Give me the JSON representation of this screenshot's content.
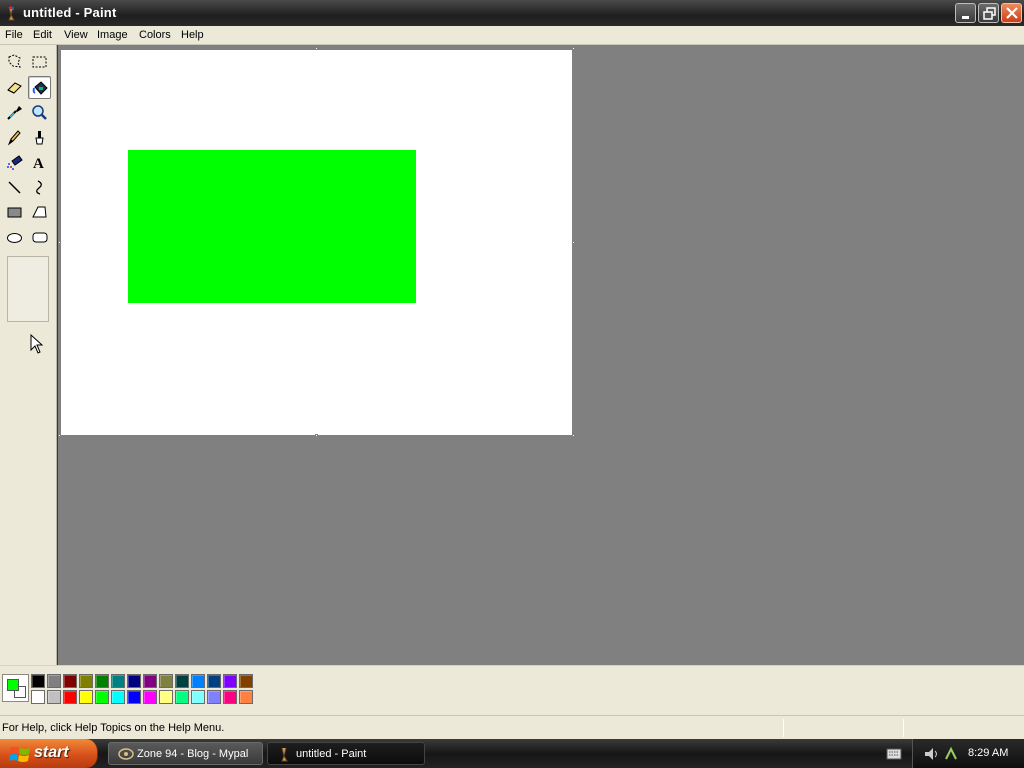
{
  "window": {
    "title": "untitled - Paint"
  },
  "menu": {
    "items": [
      "File",
      "Edit",
      "View",
      "Image",
      "Colors",
      "Help"
    ]
  },
  "toolbox": {
    "tools": [
      {
        "name": "free-form-select",
        "icon": "free-select-icon"
      },
      {
        "name": "select",
        "icon": "rect-select-icon"
      },
      {
        "name": "eraser",
        "icon": "eraser-icon"
      },
      {
        "name": "fill-with-color",
        "icon": "paint-bucket-icon",
        "active": true
      },
      {
        "name": "pick-color",
        "icon": "eyedropper-icon"
      },
      {
        "name": "magnifier",
        "icon": "magnifier-icon"
      },
      {
        "name": "pencil",
        "icon": "pencil-icon"
      },
      {
        "name": "brush",
        "icon": "brush-icon"
      },
      {
        "name": "airbrush",
        "icon": "airbrush-icon"
      },
      {
        "name": "text",
        "icon": "text-icon"
      },
      {
        "name": "line",
        "icon": "line-icon"
      },
      {
        "name": "curve",
        "icon": "curve-icon"
      },
      {
        "name": "rectangle",
        "icon": "rectangle-icon"
      },
      {
        "name": "polygon",
        "icon": "polygon-icon"
      },
      {
        "name": "ellipse",
        "icon": "ellipse-icon"
      },
      {
        "name": "rounded-rectangle",
        "icon": "rounded-rectangle-icon"
      }
    ],
    "text_tool_glyph": "A"
  },
  "canvas": {
    "background": "#ffffff",
    "shape_color": "#00ff00"
  },
  "palette": {
    "foreground": "#00ff00",
    "background": "#ffffff",
    "row1": [
      "#000000",
      "#808080",
      "#800000",
      "#808000",
      "#008000",
      "#008080",
      "#000080",
      "#800080",
      "#808040",
      "#004040",
      "#0080ff",
      "#004080",
      "#8000ff",
      "#804000"
    ],
    "row2": [
      "#ffffff",
      "#c0c0c0",
      "#ff0000",
      "#ffff00",
      "#00ff00",
      "#00ffff",
      "#0000ff",
      "#ff00ff",
      "#ffff80",
      "#00ff80",
      "#80ffff",
      "#8080ff",
      "#ff0080",
      "#ff8040"
    ]
  },
  "status": {
    "help_text": "For Help, click Help Topics on the Help Menu."
  },
  "taskbar": {
    "start_label": "start",
    "tasks": [
      {
        "label": "Zone 94 - Blog - Mypal",
        "active": false
      },
      {
        "label": "untitled - Paint",
        "active": true
      }
    ],
    "clock": "8:29 AM"
  }
}
